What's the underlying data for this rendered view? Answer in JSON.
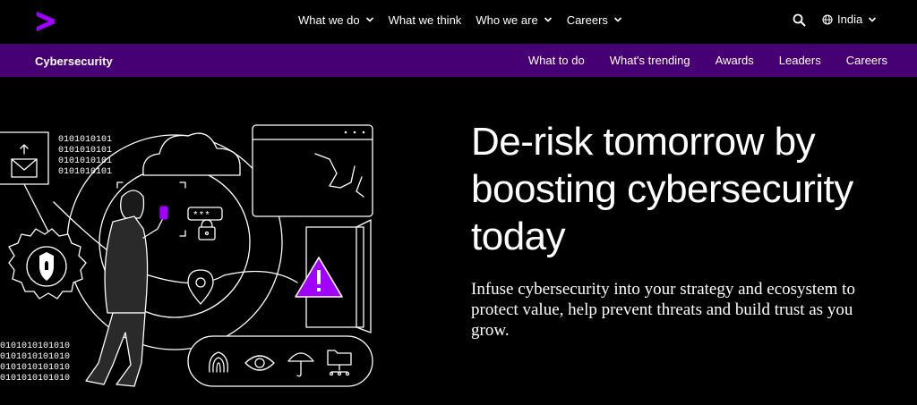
{
  "topnav": {
    "items": [
      {
        "label": "What we do",
        "has_dropdown": true
      },
      {
        "label": "What we think",
        "has_dropdown": false
      },
      {
        "label": "Who we are",
        "has_dropdown": true
      },
      {
        "label": "Careers",
        "has_dropdown": true
      }
    ],
    "region_label": "India"
  },
  "subnav": {
    "brand": "Cybersecurity",
    "links": [
      "What to do",
      "What's trending",
      "Awards",
      "Leaders",
      "Careers"
    ]
  },
  "hero": {
    "headline": "De-risk tomorrow by boosting cybersecurity today",
    "subtext": "Infuse cybersecurity into your strategy and ecosystem to protect value, help prevent threats and build trust as you grow.",
    "password_mask": "***",
    "binary_top": [
      "0101010101",
      "0101010101",
      "0101010101",
      "0101010101"
    ],
    "binary_bottom": [
      "0101010101010",
      "0101010101010",
      "0101010101010",
      "0101010101010"
    ]
  },
  "colors": {
    "background": "#000000",
    "accent": "#A100FF",
    "subnav_bg": "#460073"
  }
}
